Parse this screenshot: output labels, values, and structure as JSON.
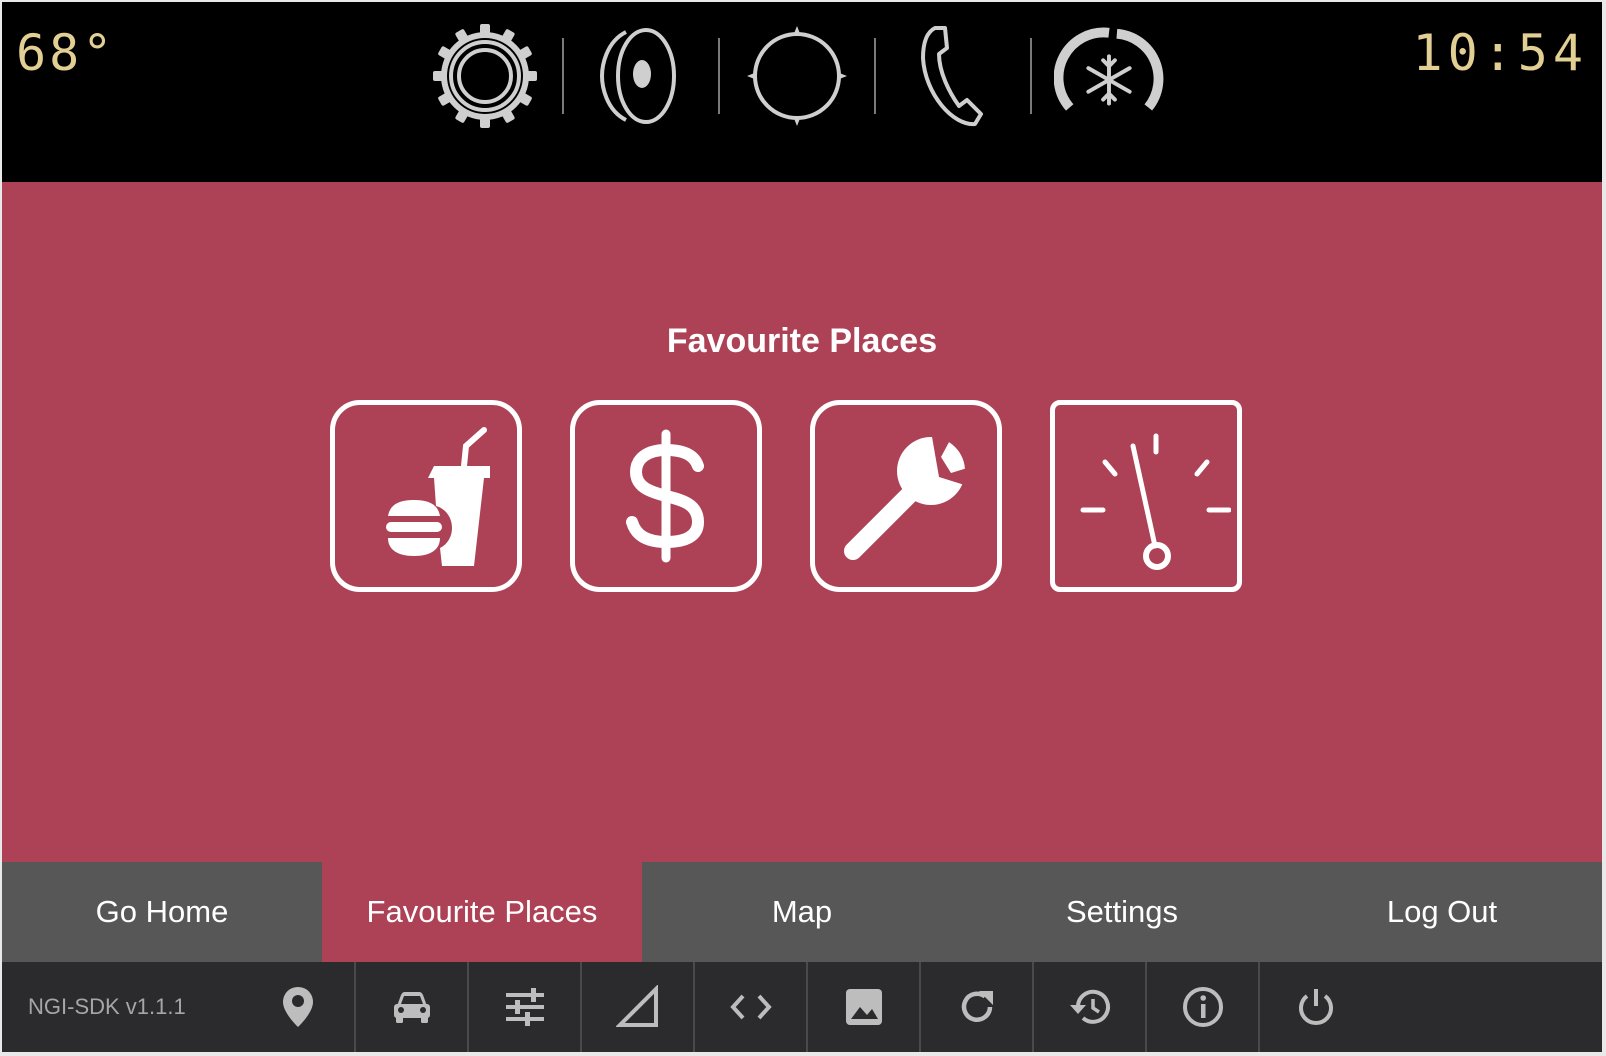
{
  "status_bar": {
    "temperature": "68°",
    "time": "10:54",
    "icons": [
      "settings-gear-icon",
      "audio-speaker-icon",
      "navigation-compass-icon",
      "phone-icon",
      "climate-fan-icon"
    ]
  },
  "main": {
    "title": "Favourite Places",
    "places": [
      "fast-food-icon",
      "dollar-icon",
      "wrench-icon",
      "gauge-icon"
    ]
  },
  "tabs": [
    {
      "label": "Go Home"
    },
    {
      "label": "Favourite Places",
      "active": true
    },
    {
      "label": "Map"
    },
    {
      "label": "Settings"
    },
    {
      "label": "Log Out"
    }
  ],
  "footer": {
    "version": "NGI-SDK v1.1.1",
    "icons": [
      "location-pin-icon",
      "car-icon",
      "sliders-icon",
      "signal-triangle-icon",
      "code-icon",
      "image-icon",
      "refresh-icon",
      "history-icon",
      "info-icon",
      "power-icon"
    ]
  },
  "colors": {
    "accent": "#ad4257",
    "status_text": "#e2cf94",
    "tab_bar": "#575757",
    "footer": "#2b2b2d"
  }
}
